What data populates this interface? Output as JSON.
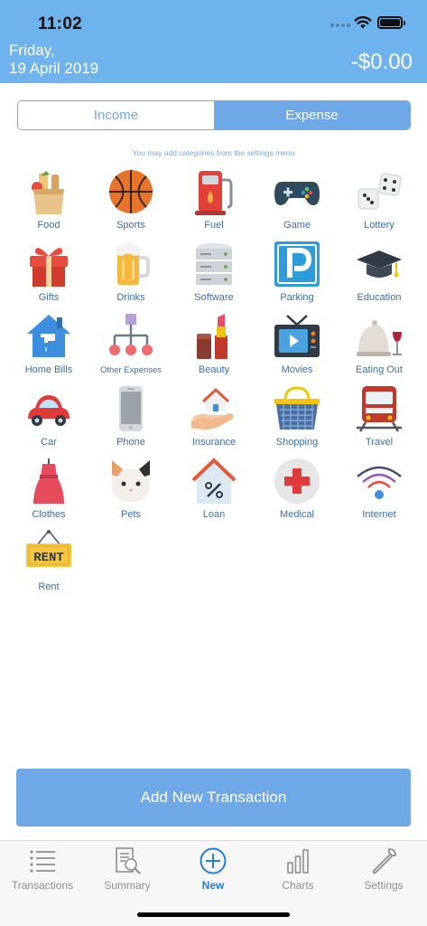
{
  "status": {
    "time": "11:02"
  },
  "header": {
    "day": "Friday,",
    "date": "19 April 2019",
    "total": "-$0.00"
  },
  "segment": {
    "income": "Income",
    "expense": "Expense",
    "selected": "Expense"
  },
  "hint": "You may add categories from the settings menu",
  "categories": [
    {
      "label": "Food",
      "icon": "grocery-bag-icon"
    },
    {
      "label": "Sports",
      "icon": "basketball-icon"
    },
    {
      "label": "Fuel",
      "icon": "fuel-pump-icon"
    },
    {
      "label": "Game",
      "icon": "gamepad-icon"
    },
    {
      "label": "Lottery",
      "icon": "dice-icon"
    },
    {
      "label": "Gifts",
      "icon": "gift-icon"
    },
    {
      "label": "Drinks",
      "icon": "beer-mug-icon"
    },
    {
      "label": "Software",
      "icon": "server-icon"
    },
    {
      "label": "Parking",
      "icon": "parking-sign-icon"
    },
    {
      "label": "Education",
      "icon": "graduation-cap-icon"
    },
    {
      "label": "Home Bills",
      "icon": "house-faucet-icon"
    },
    {
      "label": "Other Expenses",
      "icon": "hierarchy-icon"
    },
    {
      "label": "Beauty",
      "icon": "lipstick-icon"
    },
    {
      "label": "Movies",
      "icon": "tv-icon"
    },
    {
      "label": "Eating Out",
      "icon": "cloche-icon"
    },
    {
      "label": "Car",
      "icon": "car-icon"
    },
    {
      "label": "Phone",
      "icon": "phone-icon"
    },
    {
      "label": "Insurance",
      "icon": "hand-house-icon"
    },
    {
      "label": "Shopping",
      "icon": "basket-icon"
    },
    {
      "label": "Travel",
      "icon": "train-icon"
    },
    {
      "label": "Clothes",
      "icon": "dress-icon"
    },
    {
      "label": "Pets",
      "icon": "cat-icon"
    },
    {
      "label": "Loan",
      "icon": "house-percent-icon"
    },
    {
      "label": "Medical",
      "icon": "medical-cross-icon"
    },
    {
      "label": "Internet",
      "icon": "wifi-signal-icon"
    },
    {
      "label": "Rent",
      "icon": "rent-sign-icon"
    }
  ],
  "add_button": "Add New Transaction",
  "tabs": [
    {
      "label": "Transactions",
      "icon": "list-icon"
    },
    {
      "label": "Summary",
      "icon": "report-icon"
    },
    {
      "label": "New",
      "icon": "plus-circle-icon",
      "active": true
    },
    {
      "label": "Charts",
      "icon": "bar-chart-icon"
    },
    {
      "label": "Settings",
      "icon": "wrench-icon"
    }
  ],
  "colors": {
    "header": "#6fb3ee",
    "accent": "#6fa8e6",
    "active_tab": "#1f7ee0",
    "label": "#3a6ea5"
  }
}
